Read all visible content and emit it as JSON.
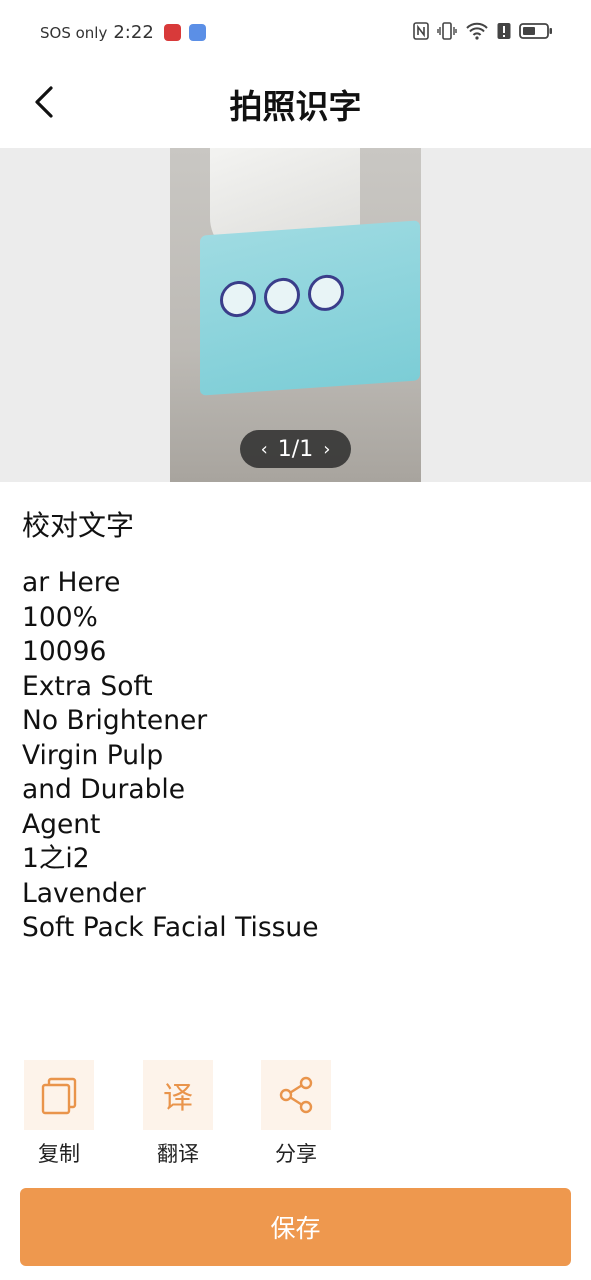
{
  "status_bar": {
    "carrier": "SOS only",
    "time": "2:22",
    "icons": [
      "nfc-icon",
      "vibrate-icon",
      "wifi-icon",
      "alert-icon",
      "battery-icon"
    ]
  },
  "header": {
    "title": "拍照识字",
    "back_icon": "chevron-left-icon"
  },
  "image_viewer": {
    "page_indicator": "1/1",
    "prev_icon": "chevron-left-icon",
    "next_icon": "chevron-right-icon"
  },
  "proofread": {
    "label": "校对文字",
    "lines": [
      "ar Here",
      "100%",
      "10096",
      "Extra Soft",
      "No Brightener",
      "Virgin Pulp",
      "and Durable",
      "Agent",
      "1之i2",
      "Lavender",
      "Soft Pack Facial Tissue"
    ]
  },
  "actions": {
    "copy": {
      "label": "复制",
      "icon": "copy-icon"
    },
    "translate": {
      "label": "翻译",
      "glyph": "译",
      "icon": "translate-icon"
    },
    "share": {
      "label": "分享",
      "icon": "share-icon"
    }
  },
  "save_button": {
    "label": "保存"
  },
  "colors": {
    "accent": "#ee984e",
    "icon_tile": "#fdf3ea",
    "image_background": "#ececec"
  }
}
